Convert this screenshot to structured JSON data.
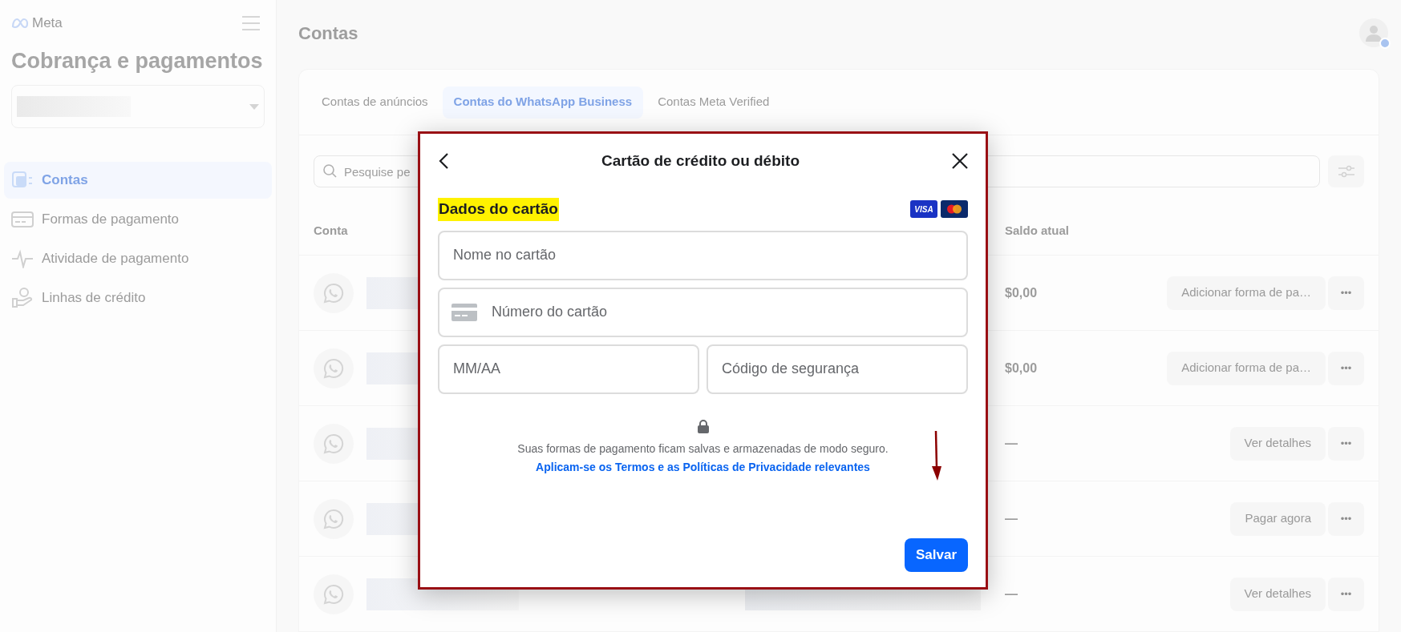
{
  "sidebar": {
    "brand": "Meta",
    "title": "Cobrança e pagamentos",
    "items": [
      {
        "label": "Contas",
        "selected": true
      },
      {
        "label": "Formas de pagamento",
        "selected": false
      },
      {
        "label": "Atividade de pagamento",
        "selected": false
      },
      {
        "label": "Linhas de crédito",
        "selected": false
      }
    ]
  },
  "header": {
    "title": "Contas"
  },
  "tabs": [
    {
      "label": "Contas de anúncios",
      "selected": false
    },
    {
      "label": "Contas do WhatsApp Business",
      "selected": true
    },
    {
      "label": "Contas Meta Verified",
      "selected": false
    }
  ],
  "search": {
    "placeholder": "Pesquise pe"
  },
  "table": {
    "columns": [
      "Conta",
      "Saldo atual"
    ],
    "rows": [
      {
        "balance": "$0,00",
        "action": "Adicionar forma de pa…",
        "more": "•••"
      },
      {
        "balance": "$0,00",
        "action": "Adicionar forma de pa…",
        "more": "•••"
      },
      {
        "balance": "—",
        "action": "Ver detalhes",
        "more": "•••"
      },
      {
        "balance": "—",
        "action": "Pagar agora",
        "more": "•••"
      },
      {
        "balance": "—",
        "action": "Ver detalhes",
        "more": "•••"
      }
    ]
  },
  "dialog": {
    "title": "Cartão de crédito ou débito",
    "section": "Dados do cartão",
    "card_brands": [
      "VISA"
    ],
    "fields": [
      {
        "placeholder": "Nome no cartão",
        "kind": "plain"
      },
      {
        "placeholder": "Número do cartão",
        "kind": "card"
      },
      {
        "placeholder": "MM/AA",
        "kind": "plain"
      },
      {
        "placeholder": "Código de segurança",
        "kind": "plain"
      }
    ],
    "note": "Suas formas de pagamento ficam salvas e armazenadas de modo seguro.",
    "link": "Aplicam-se os Termos e as Políticas de Privacidade relevantes",
    "save": "Salvar"
  }
}
